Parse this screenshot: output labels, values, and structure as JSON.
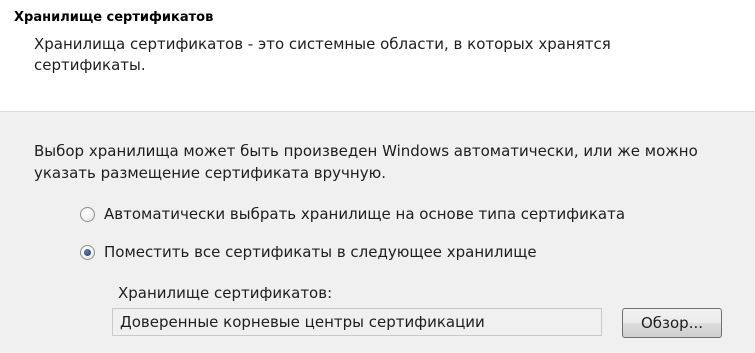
{
  "header": {
    "title": "Хранилище сертификатов",
    "description": "Хранилища сертификатов - это системные области, в которых хранятся сертификаты."
  },
  "main": {
    "intro": "Выбор хранилища может быть произведен Windows автоматически, или же можно указать размещение сертификата вручную.",
    "radio_options": [
      {
        "label": "Автоматически выбрать хранилище на основе типа сертификата",
        "selected": false
      },
      {
        "label": "Поместить все сертификаты в следующее хранилище",
        "selected": true
      }
    ],
    "store_label": "Хранилище сертификатов:",
    "store_value": "Доверенные корневые центры сертификации",
    "browse_label": "Обзор..."
  }
}
